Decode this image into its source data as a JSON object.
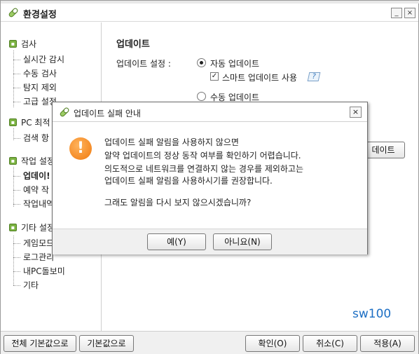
{
  "window": {
    "title": "환경설정",
    "min_label": "_",
    "close_label": "×"
  },
  "sidebar": {
    "sections": [
      {
        "label": "검사",
        "items": [
          "실시간 감시",
          "수동 검사",
          "탐지 제외",
          "고급 설정"
        ]
      },
      {
        "label": "PC 최적",
        "items": [
          "검색 항"
        ]
      },
      {
        "label": "작업 설정",
        "items": [
          "업데이!",
          "예약 작",
          "작업내역"
        ]
      },
      {
        "label": "기타 설정",
        "items": [
          "게임모드",
          "로그관리",
          "내PC돌보미",
          "기타"
        ]
      }
    ]
  },
  "main": {
    "heading": "업데이트",
    "setting_label": "업데이트 설정 :",
    "auto_update": "자동 업데이트",
    "smart_update": "스마트 업데이트 사용",
    "help_label": "?",
    "manual_update": "수동 업데이트",
    "partial_button": "데이트",
    "watermark": "sw100"
  },
  "bottom": {
    "reset_all": "전체 기본값으로",
    "reset": "기본값으로",
    "ok": "확인(O)",
    "cancel": "취소(C)",
    "apply": "적용(A)"
  },
  "dialog": {
    "title": "업데이트 실패 안내",
    "close": "×",
    "icon_glyph": "!",
    "lines": [
      "업데이트 실패 알림을 사용하지 않으면",
      "알약 업데이트의 정상 동작 여부를 확인하기 어렵습니다.",
      "의도적으로 네트워크를 연결하지 않는 경우를 제외하고는",
      "업데이트 실패 알림을 사용하시기를 권장합니다."
    ],
    "question": "그래도 알림을 다시 보지 않으시겠습니까?",
    "yes": "예(Y)",
    "no": "아니요(N)"
  },
  "colors": {
    "accent_green": "#7cb342",
    "warning_orange": "#f07a10",
    "watermark_blue": "#1d6fc4"
  }
}
